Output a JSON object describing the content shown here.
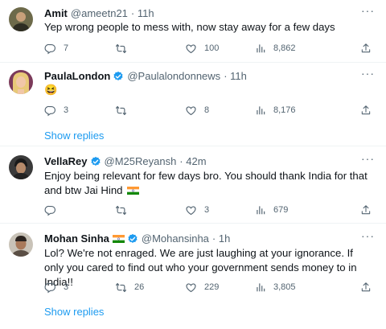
{
  "colors": {
    "verified": "#1d9bf0",
    "link": "#1d9bf0",
    "muted": "#536471",
    "text": "#0f1419"
  },
  "tweets": [
    {
      "name": "Amit",
      "handle": "@ameetn21",
      "time": "· 11h",
      "text": "Yep wrong people to mess with, now stay away for a few days",
      "replies": "7",
      "retweets": "",
      "likes": "100",
      "views": "8,862",
      "verified": false
    },
    {
      "name": "PaulaLondon",
      "handle": "@Paulalondonnews",
      "time": "· 11h",
      "text": "😆",
      "replies": "3",
      "retweets": "",
      "likes": "8",
      "views": "8,176",
      "verified": true,
      "show_replies": "Show replies"
    },
    {
      "name": "VellaRey",
      "handle": "@M25Reyansh",
      "time": "· 42m",
      "text": "Enjoy being relevant for few days bro. You should thank India for that and btw Jai Hind",
      "replies": "",
      "retweets": "",
      "likes": "3",
      "views": "679",
      "verified": true
    },
    {
      "name": "Mohan Sinha",
      "handle": "@Mohansinha",
      "time": "· 1h",
      "text": "Lol? We're not enraged. We are just laughing at your ignorance. If only you cared to find out who your government sends money to in India!!",
      "replies": "3",
      "retweets": "26",
      "likes": "229",
      "views": "3,805",
      "verified": true,
      "show_replies": "Show replies"
    }
  ],
  "icons": [
    "more-icon",
    "reply-icon",
    "retweet-icon",
    "like-icon",
    "views-icon",
    "share-icon",
    "verified-badge-icon",
    "india-flag-icon"
  ]
}
